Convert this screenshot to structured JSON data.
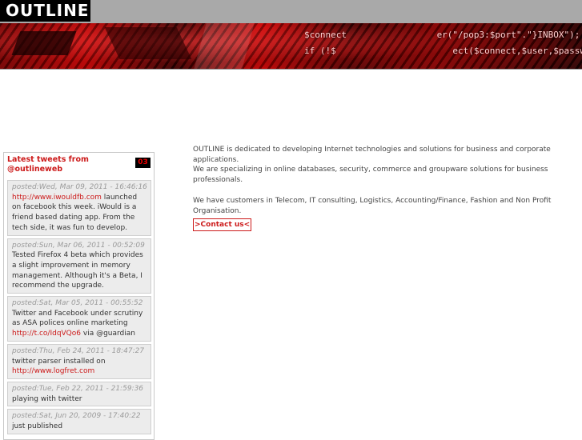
{
  "header": {
    "logo": "OUTLINE",
    "code_line_1": "$connect                 er(\"/pop3:$port\".\"}INBOX\");",
    "code_line_2": "if (!$                      ect($connect,$user,$passwd, OP_READONLY))"
  },
  "sidebar": {
    "title": "Latest tweets from @outlineweb",
    "badge": "03",
    "tweets": [
      {
        "date": "posted:Wed, Mar 09, 2011 - 16:46:16",
        "link": "http://www.iwouldfb.com",
        "text_after": " launched on facebook this week. iWould is a friend based dating app. From the tech side, it was fun to develop."
      },
      {
        "date": "posted:Sun, Mar 06, 2011 - 00:52:09",
        "text": "Tested Firefox 4 beta which provides a slight improvement in memory management. Although it's a Beta, I recommend the upgrade."
      },
      {
        "date": "posted:Sat, Mar 05, 2011 - 00:55:52",
        "text": "Twitter and Facebook under scrutiny as ASA polices online marketing ",
        "link": "http://t.co/IdqVQo6",
        "text_after": " via @guardian"
      },
      {
        "date": "posted:Thu, Feb 24, 2011 - 18:47:27",
        "text": "twitter parser installed on ",
        "link": "http://www.logfret.com"
      },
      {
        "date": "posted:Tue, Feb 22, 2011 - 21:59:36",
        "text": "playing with twitter"
      },
      {
        "date": "posted:Sat, Jun 20, 2009 - 17:40:22",
        "text": "just published"
      }
    ]
  },
  "main": {
    "para1_line1": "OUTLINE is dedicated to developing Internet technologies and solutions for business and corporate applications.",
    "para1_line2": "We are specializing in online databases, security, commerce and groupware solutions for business professionals.",
    "para2": "We have customers in Telecom, IT consulting, Logistics, Accounting/Finance, Fashion and Non Profit Organisation.",
    "contact_label": ">Contact us<"
  },
  "colors": {
    "accent": "#cc1a1a",
    "topbar": "#a9a9a9"
  }
}
